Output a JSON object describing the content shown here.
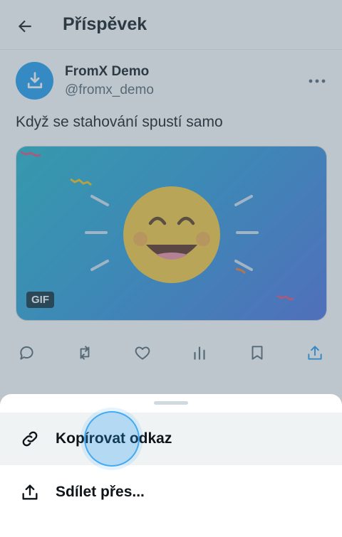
{
  "header": {
    "title": "Příspěvek",
    "back_icon": "arrow-left-icon"
  },
  "post": {
    "author_name": "FromX Demo",
    "author_handle": "@fromx_demo",
    "text": "Když se stahování spustí samo",
    "media_badge": "GIF",
    "avatar_icon": "download-icon",
    "more_icon": "ellipsis-icon"
  },
  "actions": [
    {
      "icon": "reply-icon"
    },
    {
      "icon": "retweet-icon"
    },
    {
      "icon": "like-icon"
    },
    {
      "icon": "views-icon"
    },
    {
      "icon": "bookmark-icon"
    },
    {
      "icon": "share-icon"
    }
  ],
  "sheet": {
    "items": [
      {
        "label": "Kopírovat odkaz",
        "icon": "link-icon",
        "state": "pressed"
      },
      {
        "label": "Sdílet přes...",
        "icon": "share-icon"
      }
    ]
  },
  "colors": {
    "accent": "#1d9bf0",
    "text": "#0f1419",
    "muted": "#536471",
    "overlay": "#5b7083"
  }
}
